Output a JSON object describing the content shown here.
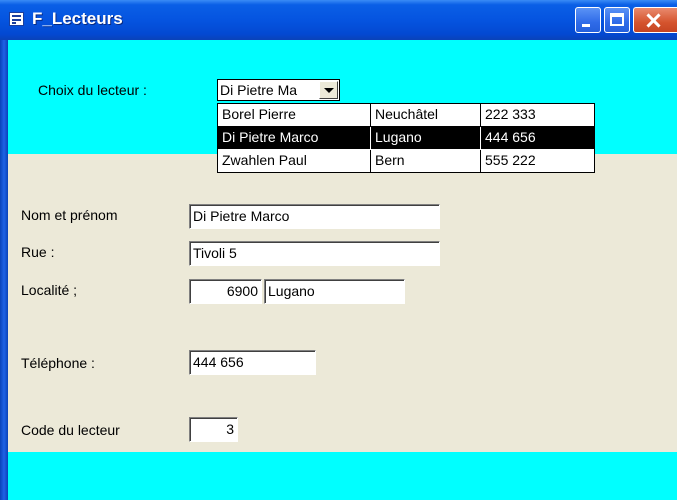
{
  "window": {
    "title": "F_Lecteurs",
    "icon": "form-icon",
    "controls": [
      "minimize-icon",
      "maximize-icon",
      "close-icon"
    ]
  },
  "colors": {
    "header_band": "#00FFFF",
    "form_body": "#ECE9D8",
    "titlebar": "#0554E0",
    "selected_row": "#000000"
  },
  "choice": {
    "label": "Choix du lecteur :",
    "value": "Di Pietre Ma"
  },
  "dropdown": {
    "rows": [
      {
        "name": "Borel Pierre",
        "city": "Neuchâtel",
        "phone": "222 333",
        "selected": false
      },
      {
        "name": "Di Pietre Marco",
        "city": "Lugano",
        "phone": "444 656",
        "selected": true
      },
      {
        "name": "Zwahlen Paul",
        "city": "Bern",
        "phone": "555 222",
        "selected": false
      }
    ]
  },
  "form": {
    "name_label": "Nom et prénom",
    "name_value": "Di Pietre Marco",
    "street_label": "Rue :",
    "street_value": "Tivoli 5",
    "locality_label": "Localité ;",
    "postcode_value": "6900",
    "city_value": "Lugano",
    "phone_label": "Téléphone :",
    "phone_value": "444 656",
    "code_label": "Code du lecteur",
    "code_value": "3"
  }
}
